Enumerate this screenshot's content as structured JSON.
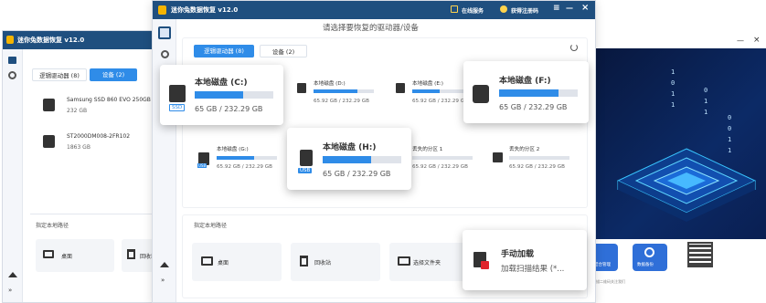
{
  "back_window": {
    "title": "迷你兔数据恢复 v12.0",
    "tabs": [
      "逻辑驱动器 (8)",
      "设备 (2)"
    ],
    "devices": [
      {
        "name": "Samsung SSD 860 EVO 250GB",
        "size": "232 GB"
      },
      {
        "name": "ST2000DM008-2FR102",
        "size": "1863 GB"
      }
    ],
    "specify_path": "指定本地路径",
    "shortcuts": [
      "桌面",
      "回收站"
    ]
  },
  "main_window": {
    "title": "迷你兔数据恢复 v12.0",
    "header_links": [
      "在线服务",
      "获得注册码"
    ],
    "heading": "请选择要恢复的驱动器/设备",
    "tabs": [
      "逻辑驱动器 (8)",
      "设备 (2)"
    ],
    "drives_row1": [
      {
        "name": "本地磁盘 (D:)",
        "size": "65.92 GB / 232.29 GB",
        "fill": 0.72
      },
      {
        "name": "本地磁盘 (E:)",
        "size": "65.92 GB / 232.29 GB",
        "fill": 0.45
      }
    ],
    "drives_row2": [
      {
        "name": "本地磁盘 (G:)",
        "size": "65.92 GB / 232.29 GB",
        "fill": 0.62
      },
      {
        "name": "丢失的分区 1",
        "size": "65.92 GB / 232.29 GB",
        "fill": 0.0
      },
      {
        "name": "丢失的分区 2",
        "size": "65.92 GB / 232.29 GB",
        "fill": 0.0
      }
    ],
    "usb_badge": "USB",
    "specify_path": "指定本地路径",
    "shortcuts": [
      "桌面",
      "回收站",
      "选择文件夹"
    ]
  },
  "cards": {
    "c_drive": {
      "name": "本地磁盘 (C:)",
      "size": "65 GB / 232.29 GB",
      "fill": 0.62,
      "badge": "SSD"
    },
    "f_drive": {
      "name": "本地磁盘 (F:)",
      "size": "65 GB / 232.29 GB",
      "fill": 0.75
    },
    "h_drive": {
      "name": "本地磁盘 (H:)",
      "size": "65 GB / 232.29 GB",
      "fill": 0.62,
      "badge": "USB"
    },
    "manual_load": {
      "title": "手动加载",
      "subtitle": "加载扫描结果 (*..."
    }
  },
  "right_window": {
    "binary_digits": [
      "1",
      "0",
      "1",
      "1",
      "0",
      "1",
      "1",
      "0",
      "0",
      "1",
      "1"
    ],
    "footer_buttons": [
      "结合管理",
      "数据备份"
    ],
    "footer_note": "扫描二维码关注我们"
  },
  "colors": {
    "accent": "#2f8ce8",
    "titlebar": "#1f4f7f",
    "dark_blue": "#0b1d47"
  }
}
